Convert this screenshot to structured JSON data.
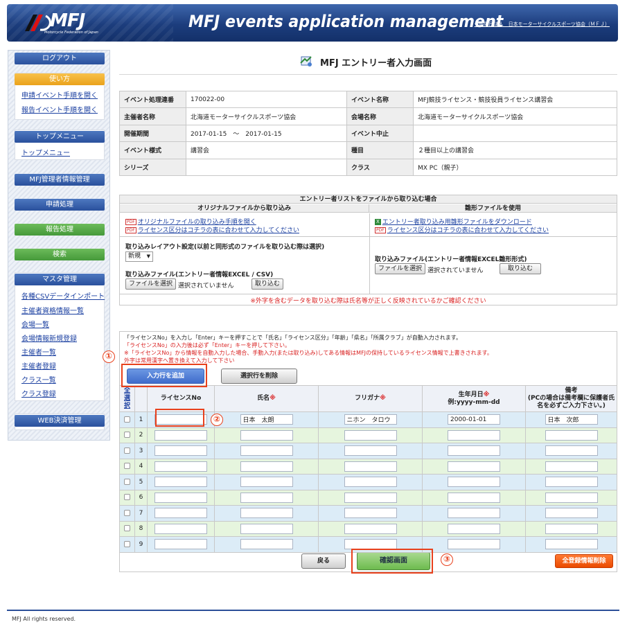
{
  "header": {
    "logo_text": "MFJ",
    "logo_subtext": "Motorcycle Federation of Japan",
    "app_title": "MFJ events application management",
    "org_name": "一般財団法人　日本モーターサイクルスポーツ協会（ＭＦＪ）"
  },
  "sidebar": {
    "logout": "ログアウト",
    "usage_head": "使い方",
    "usage_links": [
      "申請イベント手順を開く",
      "報告イベント手順を開く"
    ],
    "top_head": "トップメニュー",
    "top_links": [
      "トップメニュー"
    ],
    "admin_head": "MFJ管理者情報管理",
    "apply_head": "申請処理",
    "report_head": "報告処理",
    "search_head": "検索",
    "master_head": "マスタ管理",
    "master_links": [
      "各種CSVデータインポート",
      "主催者資格情報一覧",
      "会場一覧",
      "会場情報新規登録",
      "主催者一覧",
      "主催者登録",
      "クラス一覧",
      "クラス登録"
    ],
    "web_head": "WEB決済管理"
  },
  "page": {
    "title": "MFJ エントリー者入力画面"
  },
  "info": {
    "rows": [
      {
        "l1": "イベント処理連番",
        "v1": "170022-00",
        "l2": "イベント名称",
        "v2": "MFJ競技ライセンス・競技役員ライセンス講習会"
      },
      {
        "l1": "主催者名称",
        "v1": "北海道モーターサイクルスポーツ協会",
        "l2": "会場名称",
        "v2": "北海道モーターサイクルスポーツ協会"
      },
      {
        "l1": "開催期間",
        "v1": "2017-01-15　～　2017-01-15",
        "l2": "イベント中止",
        "v2": ""
      },
      {
        "l1": "イベント様式",
        "v1": "講習会",
        "l2": "種目",
        "v2": "２種目以上の講習会"
      },
      {
        "l1": "シリーズ",
        "v1": "",
        "l2": "クラス",
        "v2": "MX PC（親子）"
      }
    ]
  },
  "import": {
    "title": "エントリー者リストをファイルから取り込む場合",
    "left_head": "オリジナルファイルから取り込み",
    "right_head": "雛形ファイルを使用",
    "pdf_label": "PDF",
    "xls_label": "X",
    "left_link1": "オリジナルファイルの取り込み手順を開く",
    "left_link2": "ライセンス区分はコチラの表に合わせて入力してください",
    "right_link1": "エントリー者取り込み用雛形ファイルをダウンロード",
    "right_link2": "ライセンス区分はコチラの表に合わせて入力してください",
    "layout_label": "取り込みレイアウト設定(以前と同形式のファイルを取り込む際は選択)",
    "layout_value": "新規",
    "left_file_label": "取り込みファイル(エントリー者情報EXCEL / CSV)",
    "right_file_label": "取り込みファイル(エントリー者情報EXCEL雛形形式)",
    "choose_file": "ファイルを選択",
    "no_file": "選択されていません",
    "import_btn": "取り込む",
    "warning": "※外字を含むデータを取り込む際は氏名等が正しく反映されているかご確認ください"
  },
  "entry": {
    "note1": "「ライセンスNo」を入力し「Enter」キーを押すことで「氏名」「ライセンス区分」「年齢」「県名」「所属クラブ」が自動入力されます。",
    "note2": "「ライセンスNo」の入力後は必ず「Enter」キーを押して下さい。",
    "note3": "※「ライセンスNo」から情報を自動入力した場合、手動入力(または取り込み)してある情報はMFJの保持しているライセンス情報で上書きされます。",
    "note4": "外字は常用漢字へ置き換えて入力して下さい",
    "add_row": "入力行を追加",
    "delete_row": "選択行を削除",
    "callouts": [
      "①",
      "②",
      "③"
    ],
    "headers": {
      "select_all": "全選択",
      "license": "ライセンスNo",
      "name": "氏名",
      "kana": "フリガナ",
      "dob": "生年月日",
      "dob_format": "例:yyyy-mm-dd",
      "remarks": "備考",
      "remarks_note": "(PCの場合は備考欄に保護者氏名を必ずご入力下さい。)",
      "required": "※"
    },
    "rows": [
      {
        "no": "1",
        "license": "",
        "name": "日本　太朗",
        "kana": "ニホン　タロウ",
        "dob": "2000-01-01",
        "remarks": "日本　次郎"
      },
      {
        "no": "2",
        "license": "",
        "name": "",
        "kana": "",
        "dob": "",
        "remarks": ""
      },
      {
        "no": "3",
        "license": "",
        "name": "",
        "kana": "",
        "dob": "",
        "remarks": ""
      },
      {
        "no": "4",
        "license": "",
        "name": "",
        "kana": "",
        "dob": "",
        "remarks": ""
      },
      {
        "no": "5",
        "license": "",
        "name": "",
        "kana": "",
        "dob": "",
        "remarks": ""
      },
      {
        "no": "6",
        "license": "",
        "name": "",
        "kana": "",
        "dob": "",
        "remarks": ""
      },
      {
        "no": "7",
        "license": "",
        "name": "",
        "kana": "",
        "dob": "",
        "remarks": ""
      },
      {
        "no": "8",
        "license": "",
        "name": "",
        "kana": "",
        "dob": "",
        "remarks": ""
      },
      {
        "no": "9",
        "license": "",
        "name": "",
        "kana": "",
        "dob": "",
        "remarks": ""
      }
    ],
    "back": "戻る",
    "confirm": "確認画面",
    "delete_all": "全登録情報削除"
  },
  "footer": {
    "copyright": "MFJ All rights reserved."
  },
  "colors": {
    "header_blue": "#1c3d7d",
    "callout_red": "#e8401c",
    "confirm_green": "#6dbb4e",
    "delete_orange": "#ea4a00"
  }
}
